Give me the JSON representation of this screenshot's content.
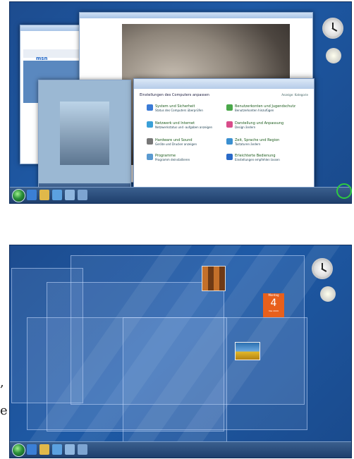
{
  "top_screenshot": {
    "windows": {
      "control_panel_title": "Einstellungen des Computers anpassen",
      "control_panel_view": "Anzeige: Kategorie",
      "categories": [
        {
          "heading": "System und Sicherheit",
          "line": "Status des Computers überprüfen"
        },
        {
          "heading": "Netzwerk und Internet",
          "line": "Netzwerkstatus und -aufgaben anzeigen"
        },
        {
          "heading": "Hardware und Sound",
          "line": "Geräte und Drucker anzeigen"
        },
        {
          "heading": "Programme",
          "line": "Programm deinstallieren"
        },
        {
          "heading": "Benutzerkonten und Jugendschutz",
          "line": "Benutzerkonten hinzufügen"
        },
        {
          "heading": "Darstellung und Anpassung",
          "line": "Design ändern"
        },
        {
          "heading": "Zeit, Sprache und Region",
          "line": "Tastaturen ändern"
        },
        {
          "heading": "Erleichterte Bedienung",
          "line": "Einstellungen empfehlen lassen"
        }
      ],
      "browser_logo": "msn"
    },
    "show_desktop_colors": {
      "ring": "#2ecc40",
      "arrow": "#1e9a3a"
    }
  },
  "bottom_screenshot": {
    "calendar": {
      "month": "Montag",
      "day": "4",
      "year": "Mai 2009"
    }
  },
  "stray_text": {
    "comma": ",",
    "e": "e"
  }
}
